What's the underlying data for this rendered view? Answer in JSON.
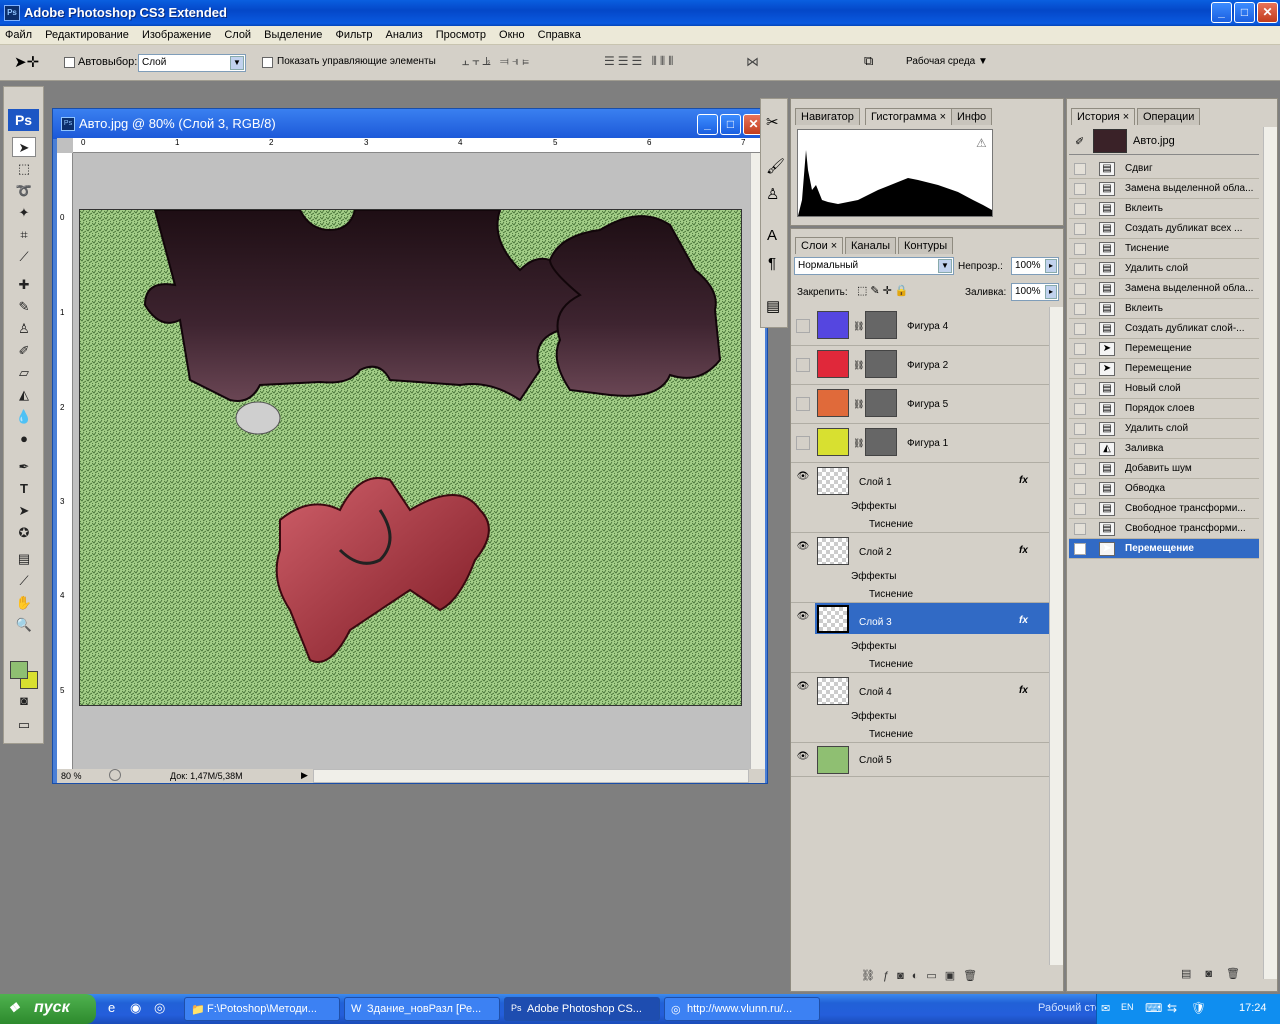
{
  "app": {
    "title": "Adobe Photoshop CS3 Extended",
    "logo": "Ps"
  },
  "window_controls": {
    "minimize": "_",
    "maximize": "□",
    "close": "✕"
  },
  "menu": [
    "Файл",
    "Редактирование",
    "Изображение",
    "Слой",
    "Выделение",
    "Фильтр",
    "Анализ",
    "Просмотр",
    "Окно",
    "Справка"
  ],
  "options": {
    "autoselect_label": "Автовыбор:",
    "autoselect_value": "Слой",
    "show_controls_label": "Показать управляющие элементы",
    "workspace_label": "Рабочая среда"
  },
  "document": {
    "title": "Авто.jpg @ 80% (Слой 3, RGB/8)",
    "zoom": "80 %",
    "doc_size": "Док: 1,47M/5,38M",
    "ruler_top": [
      "0",
      "1",
      "2",
      "3",
      "4",
      "5",
      "6",
      "7"
    ],
    "ruler_left": [
      "0",
      "1",
      "2",
      "3",
      "4",
      "5"
    ],
    "colors": {
      "background": "#a4cf88",
      "piece_dark": "#3a1f26",
      "piece_red": "#b2323c"
    }
  },
  "navigator_panel": {
    "tabs": [
      "Навигатор",
      "Гистограмма",
      "Инфо"
    ],
    "active_tab": "Гистограмма",
    "warning": "⚠"
  },
  "layers_panel": {
    "tabs": [
      "Слои",
      "Каналы",
      "Контуры"
    ],
    "blend_mode": "Нормальный",
    "opacity_label": "Непрозр.:",
    "opacity": "100%",
    "lock_label": "Закрепить:",
    "fill_label": "Заливка:",
    "fill": "100%",
    "shape_layers": [
      {
        "name": "Фигура 4",
        "color": "#5546e0"
      },
      {
        "name": "Фигура 2",
        "color": "#e0283a"
      },
      {
        "name": "Фигура 5",
        "color": "#e06a3a"
      },
      {
        "name": "Фигура 1",
        "color": "#d8e030"
      }
    ],
    "pixel_layers": [
      {
        "name": "Слой 1",
        "effects": "Эффекты",
        "effect": "Тиснение",
        "active": false
      },
      {
        "name": "Слой 2",
        "effects": "Эффекты",
        "effect": "Тиснение",
        "active": false
      },
      {
        "name": "Слой 3",
        "effects": "Эффекты",
        "effect": "Тиснение",
        "active": true
      },
      {
        "name": "Слой 4",
        "effects": "Эффекты",
        "effect": "Тиснение",
        "active": false
      }
    ],
    "bottom_layer": {
      "name": "Слой 5",
      "color": "#8fbf72"
    },
    "fx_label": "fx"
  },
  "history_panel": {
    "tabs": [
      "История",
      "Операции"
    ],
    "snapshot": "Авто.jpg",
    "items": [
      "Сдвиг",
      "Замена выделенной обла...",
      "Вклеить",
      "Создать дубликат всех ...",
      "Тиснение",
      "Удалить слой",
      "Замена выделенной обла...",
      "Вклеить",
      "Создать дубликат слой-...",
      "Перемещение",
      "Перемещение",
      "Новый слой",
      "Порядок слоев",
      "Удалить слой",
      "Заливка",
      "Добавить шум",
      "Обводка",
      "Свободное трансформи...",
      "Свободное трансформи...",
      "Перемещение"
    ],
    "active_index": 19
  },
  "taskbar": {
    "start": "пуск",
    "tasks": [
      {
        "label": "F:\\Potoshop\\Методи...",
        "active": false
      },
      {
        "label": "Здание_новРазл [Ре...",
        "active": false
      },
      {
        "label": "Adobe Photoshop CS...",
        "active": true
      },
      {
        "label": "http://www.vlunn.ru/...",
        "active": false
      }
    ],
    "desktop_label": "Рабочий стол",
    "lang": "EN",
    "clock": "17:24"
  }
}
